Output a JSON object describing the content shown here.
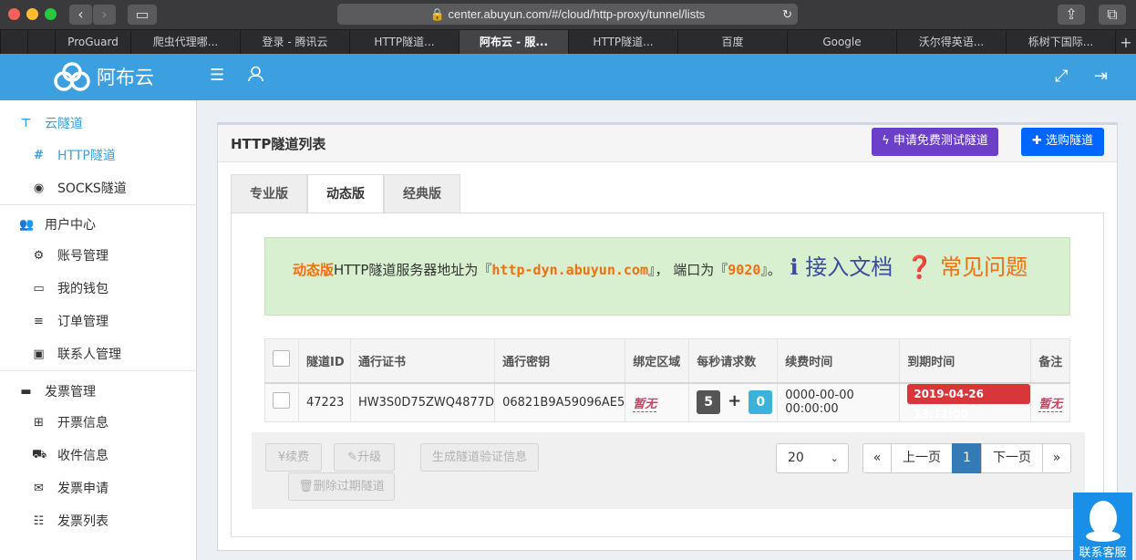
{
  "browser": {
    "url": "center.abuyun.com/#/cloud/http-proxy/tunnel/lists",
    "tabs": [
      "ProGuard",
      "爬虫代理哪...",
      "登录 - 腾讯云",
      "HTTP隧道...",
      "阿布云 - 服...",
      "HTTP隧道...",
      "百度",
      "Google",
      "沃尔得英语...",
      "栎树下国际..."
    ],
    "active_tab": 4
  },
  "header": {
    "logo_text": "阿布云"
  },
  "sidebar": {
    "groups": [
      {
        "label": "云隧道",
        "icon": "tunnel-icon",
        "items": [
          {
            "label": "HTTP隧道",
            "icon": "hash-icon",
            "active": true
          },
          {
            "label": "SOCKS隧道",
            "icon": "target-icon",
            "active": false
          }
        ]
      },
      {
        "label": "用户中心",
        "icon": "users-icon",
        "items": [
          {
            "label": "账号管理",
            "icon": "gear-icon"
          },
          {
            "label": "我的钱包",
            "icon": "wallet-icon"
          },
          {
            "label": "订单管理",
            "icon": "list-icon"
          },
          {
            "label": "联系人管理",
            "icon": "contact-card-icon"
          }
        ]
      },
      {
        "label": "发票管理",
        "icon": "folder-icon",
        "items": [
          {
            "label": "开票信息",
            "icon": "table-icon"
          },
          {
            "label": "收件信息",
            "icon": "truck-icon"
          },
          {
            "label": "发票申请",
            "icon": "envelope-icon"
          },
          {
            "label": "发票列表",
            "icon": "list-ul-icon"
          }
        ]
      }
    ]
  },
  "main": {
    "title": "HTTP隧道列表",
    "free_trial_button": "申请免费测试隧道",
    "buy_button": "选购隧道",
    "product_tabs": [
      "专业版",
      "动态版",
      "经典版"
    ],
    "active_product_tab": 1,
    "notice": {
      "edition": "动态版",
      "text1": "HTTP隧道服务器地址为『",
      "host": "http-dyn.abuyun.com",
      "text2": "』，  端口为『",
      "port": "9020",
      "text3": "』。",
      "doc_link": "接入文档",
      "faq_link": "常见问题"
    },
    "table": {
      "columns": [
        "隧道ID",
        "通行证书",
        "通行密钥",
        "绑定区域",
        "每秒请求数",
        "续费时间",
        "到期时间",
        "备注"
      ],
      "rows": [
        {
          "id": "47223",
          "license": "HW3S0D75ZWQ4877D",
          "secret": "06821B9A59096AE5",
          "region": "暂无",
          "rps_base": "5",
          "rps_extra": "0",
          "renew_time": "0000-00-00 00:00:00",
          "expire_time": "2019-04-26 13:11:00",
          "remark": "暂无"
        }
      ]
    },
    "actions": {
      "renew": "续费",
      "upgrade": "升级",
      "gen_verify": "生成隧道验证信息",
      "delete_expired": "删除过期隧道"
    },
    "pagination": {
      "page_size": "20",
      "first": "«",
      "prev": "上一页",
      "current": "1",
      "next": "下一页",
      "last": "»"
    }
  },
  "support": {
    "label": "联系客服"
  },
  "colors": {
    "header": "#3c9fe0",
    "accent": "#0066ff",
    "trial": "#6b3fc7",
    "danger": "#d9363a"
  }
}
